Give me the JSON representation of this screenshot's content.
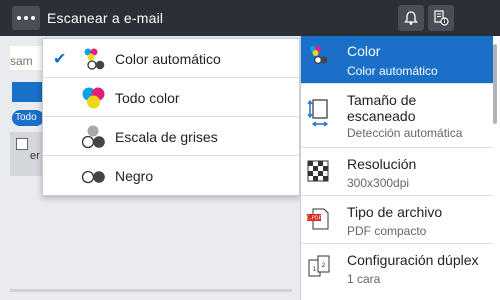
{
  "titlebar": {
    "title": "Escanear a e-mail",
    "icons": [
      "more-icon",
      "bell-icon",
      "device-info-icon"
    ]
  },
  "left": {
    "address_placeholder": "sam",
    "pill_label": "Todo",
    "list_item_text": "er"
  },
  "dropdown": {
    "items": [
      {
        "label": "Color automático",
        "checked": true,
        "icon": "auto-color-icon"
      },
      {
        "label": "Todo color",
        "checked": false,
        "icon": "full-color-icon"
      },
      {
        "label": "Escala de grises",
        "checked": false,
        "icon": "grayscale-icon"
      },
      {
        "label": "Negro",
        "checked": false,
        "icon": "black-icon"
      }
    ]
  },
  "settings": {
    "items": [
      {
        "title": "Color",
        "value": "Color automático",
        "selected": true,
        "icon": "color-icon"
      },
      {
        "title": "Tamaño de escaneado",
        "value": "Detección automática",
        "selected": false,
        "icon": "scan-size-icon"
      },
      {
        "title": "Resolución",
        "value": "300x300dpi",
        "selected": false,
        "icon": "resolution-icon"
      },
      {
        "title": "Tipo de archivo",
        "value": "PDF compacto",
        "selected": false,
        "icon": "file-type-icon"
      },
      {
        "title": "Configuración dúplex",
        "value": "1 cara",
        "selected": false,
        "icon": "duplex-icon"
      }
    ]
  },
  "colors": {
    "titlebar_bg": "#2b2f36",
    "accent": "#1a6fc9"
  }
}
